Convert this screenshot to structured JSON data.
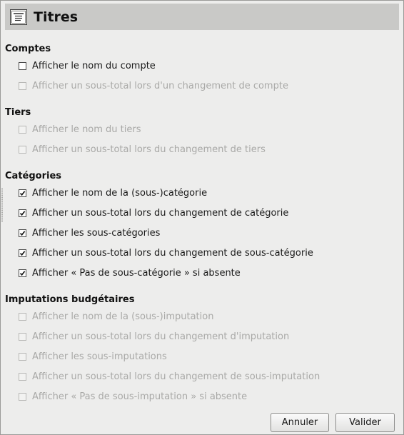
{
  "header": {
    "title": "Titres",
    "icon": "titles-icon"
  },
  "sections": {
    "comptes": {
      "title": "Comptes",
      "items": [
        {
          "label": "Afficher le nom du compte",
          "checked": false,
          "enabled": true
        },
        {
          "label": "Afficher un sous-total lors d'un changement de compte",
          "checked": false,
          "enabled": false
        }
      ]
    },
    "tiers": {
      "title": "Tiers",
      "items": [
        {
          "label": "Afficher le nom du tiers",
          "checked": false,
          "enabled": false
        },
        {
          "label": "Afficher un sous-total lors du changement de tiers",
          "checked": false,
          "enabled": false
        }
      ]
    },
    "categories": {
      "title": "Catégories",
      "items": [
        {
          "label": "Afficher le nom de la (sous-)catégorie",
          "checked": true,
          "enabled": true
        },
        {
          "label": "Afficher un sous-total lors du changement de catégorie",
          "checked": true,
          "enabled": true
        },
        {
          "label": "Afficher les sous-catégories",
          "checked": true,
          "enabled": true
        },
        {
          "label": "Afficher un sous-total lors du changement de sous-catégorie",
          "checked": true,
          "enabled": true
        },
        {
          "label": "Afficher « Pas de sous-catégorie » si absente",
          "checked": true,
          "enabled": true
        }
      ]
    },
    "imputations": {
      "title": "Imputations budgétaires",
      "items": [
        {
          "label": "Afficher le nom de la (sous-)imputation",
          "checked": false,
          "enabled": false
        },
        {
          "label": "Afficher un sous-total lors du changement d'imputation",
          "checked": false,
          "enabled": false
        },
        {
          "label": "Afficher les sous-imputations",
          "checked": false,
          "enabled": false
        },
        {
          "label": "Afficher un sous-total lors du changement de sous-imputation",
          "checked": false,
          "enabled": false
        },
        {
          "label": "Afficher « Pas de sous-imputation » si absente",
          "checked": false,
          "enabled": false
        }
      ]
    }
  },
  "buttons": {
    "cancel": "Annuler",
    "ok": "Valider"
  }
}
